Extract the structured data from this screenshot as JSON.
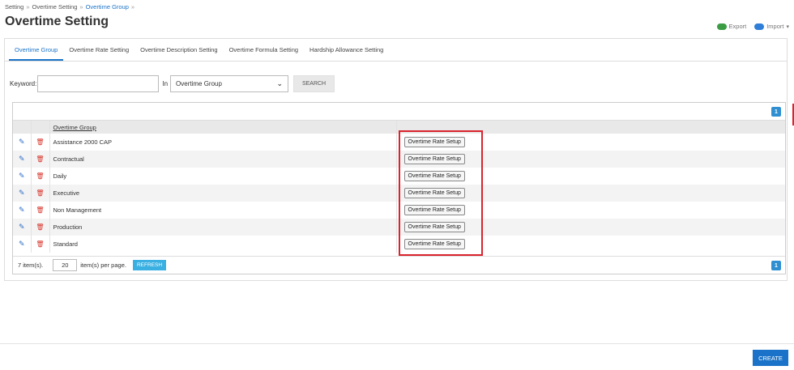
{
  "breadcrumb": [
    "Setting",
    "Overtime Setting",
    "Overtime Group"
  ],
  "title": "Overtime Setting",
  "actions": {
    "export": "Export",
    "import": "Import"
  },
  "tabs": [
    {
      "label": "Overtime Group",
      "active": true
    },
    {
      "label": "Overtime Rate Setting"
    },
    {
      "label": "Overtime Description Setting"
    },
    {
      "label": "Overtime Formula Setting"
    },
    {
      "label": "Hardship Allowance Setting"
    }
  ],
  "search": {
    "keyword_label": "Keyword:",
    "keyword_value": "",
    "in_label": "In",
    "field": "Overtime Group",
    "button": "SEARCH"
  },
  "grid": {
    "page_number": "1",
    "column_header": "Overtime Group",
    "row_button": "Overtime Rate Setup",
    "rows": [
      "Assistance 2000 CAP",
      "Contractual",
      "Daily",
      "Executive",
      "Non Management",
      "Production",
      "Standard"
    ],
    "footer": {
      "count": "7 item(s).",
      "per_page": "20",
      "per_page_label": "item(s) per page.",
      "refresh": "REFRESH"
    }
  },
  "bottom": {
    "create": "CREATE"
  },
  "colors": {
    "accent": "#1a73c8",
    "highlight": "#d9232d",
    "export_icon": "#3a9d44",
    "import_icon": "#2f7ed8"
  }
}
